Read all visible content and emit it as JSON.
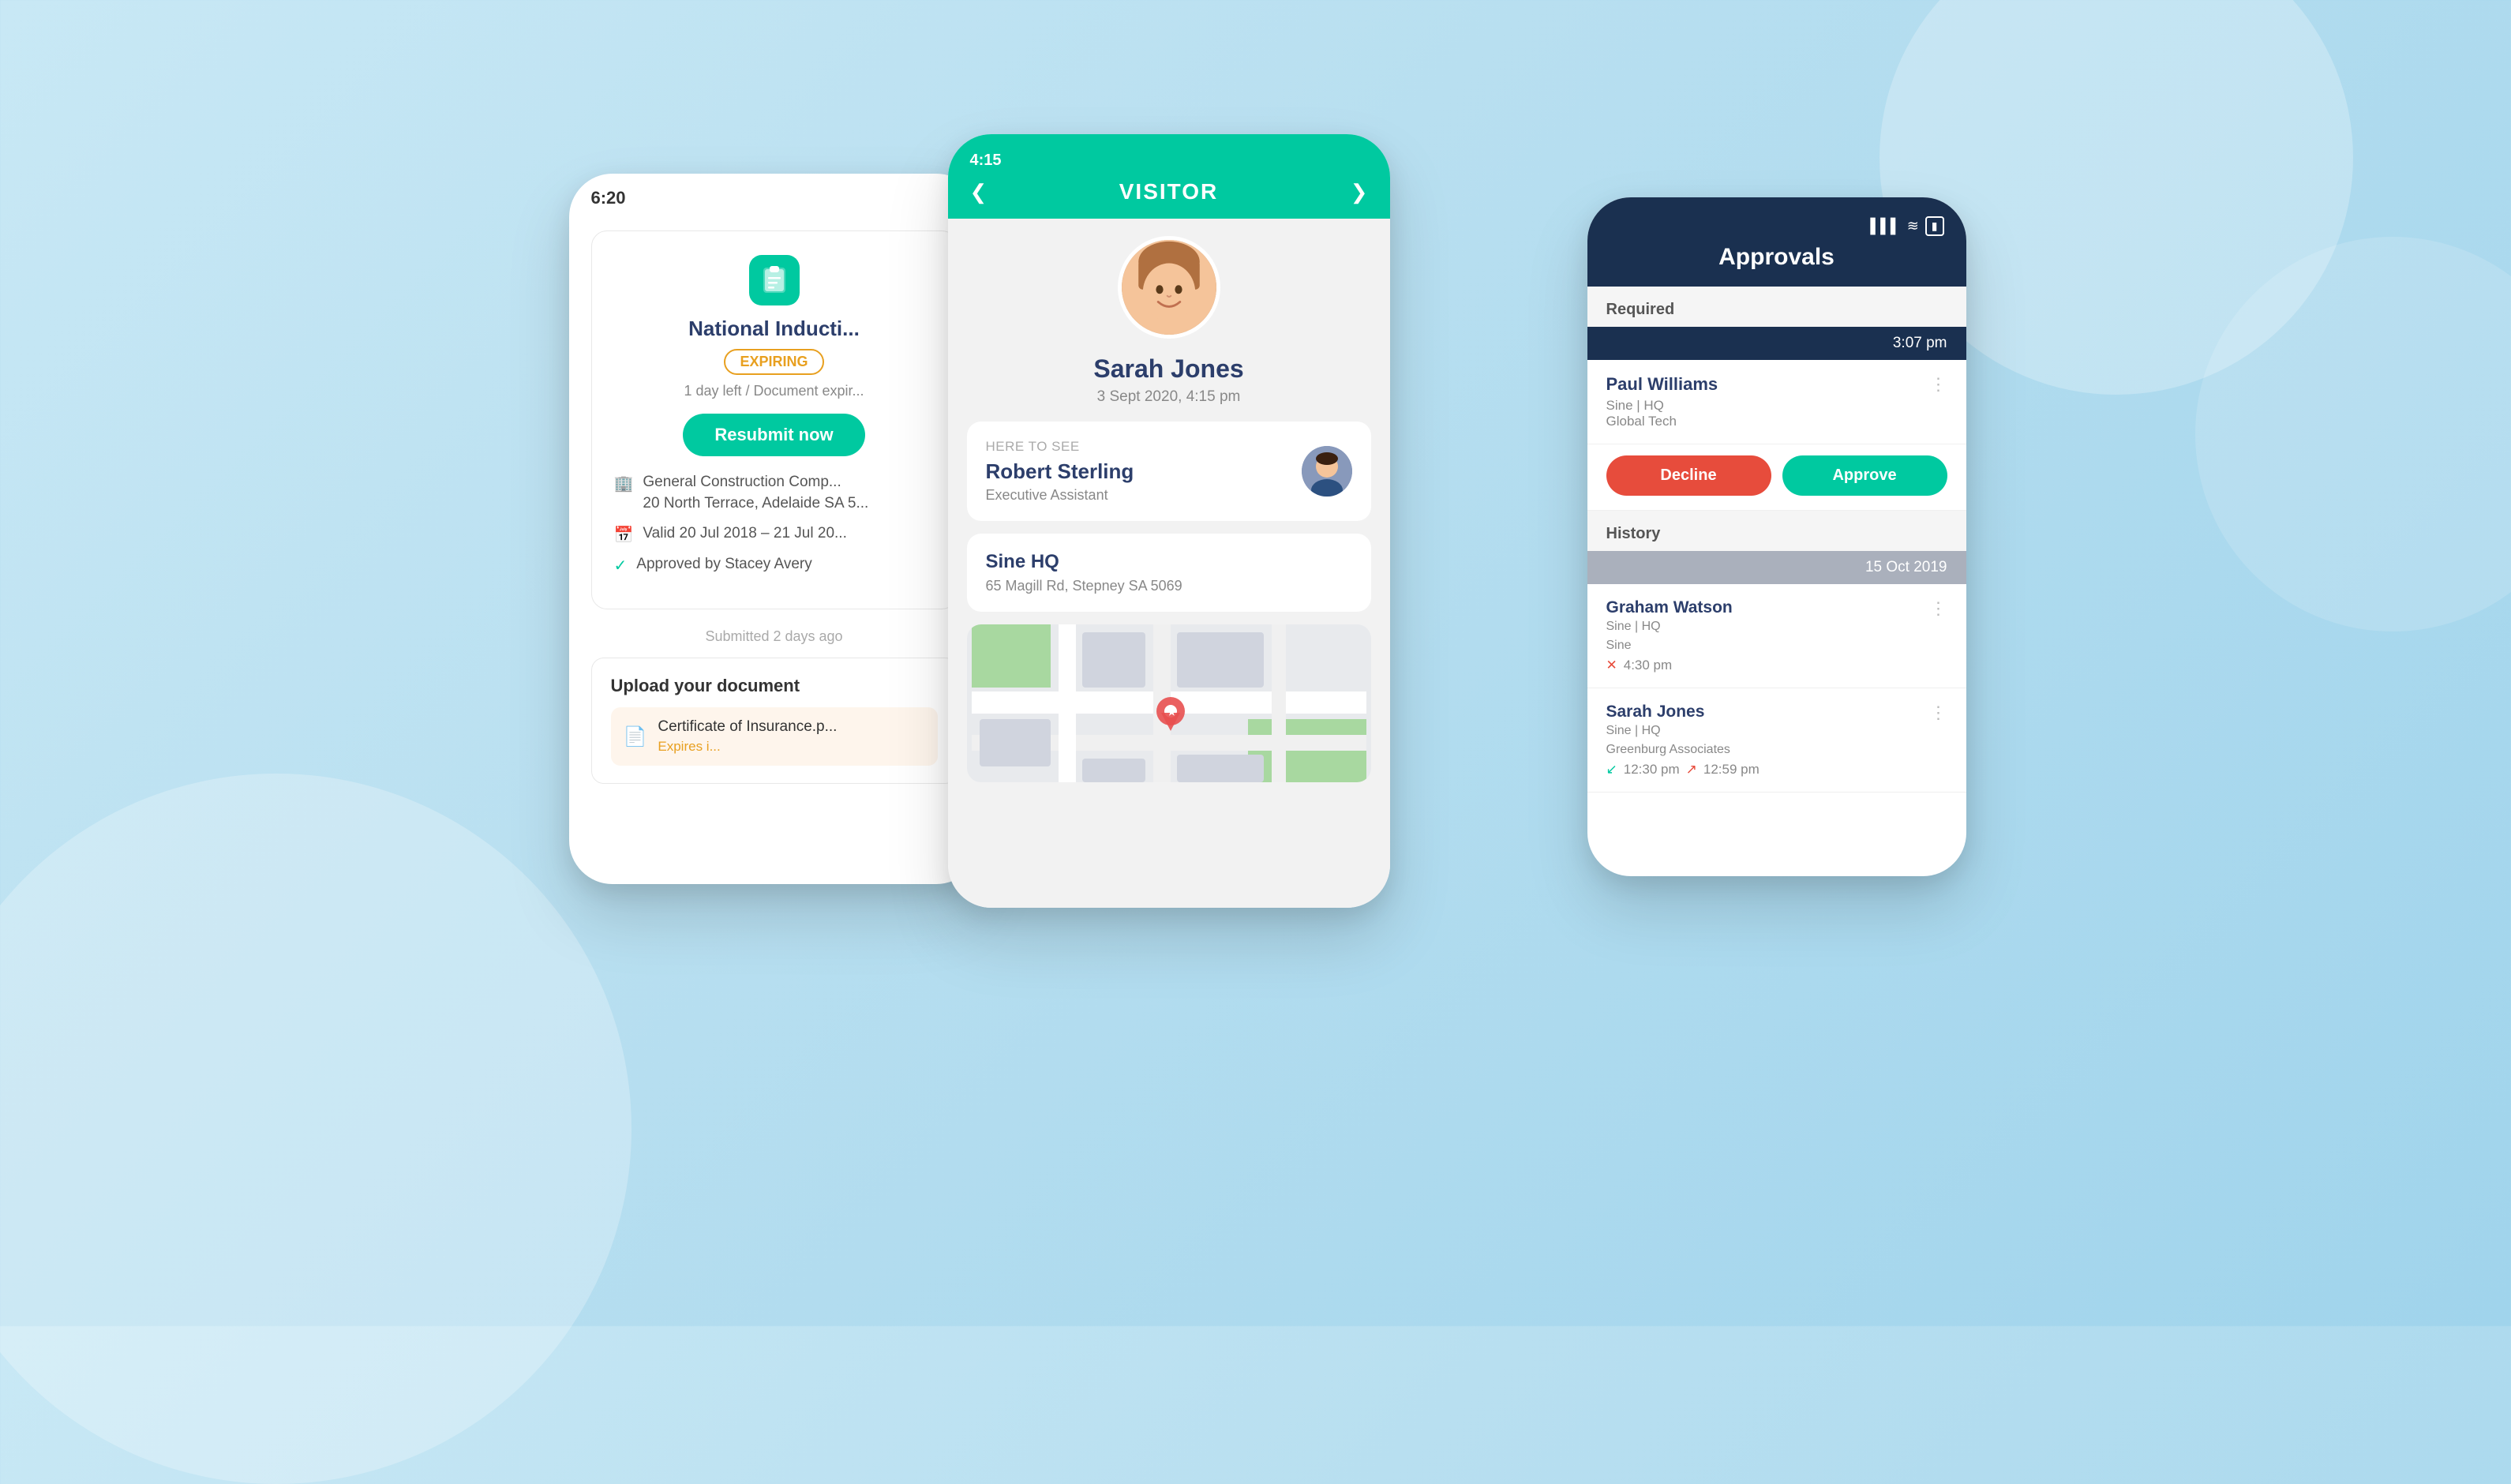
{
  "background": {
    "color": "#c2e4f5"
  },
  "phone_left": {
    "status_bar": "6:20",
    "induction_card": {
      "title": "National Inducti...",
      "badge": "EXPIRING",
      "expiry_text": "1 day left / Document expir...",
      "resubmit_label": "Resubmit now",
      "company_name": "General Construction Comp...",
      "company_address": "20 North Terrace, Adelaide SA 5...",
      "valid_dates": "Valid 20 Jul 2018 – 21 Jul 20...",
      "approved_by": "Approved by Stacey Avery"
    },
    "submitted_text": "Submitted 2 days ago",
    "upload_section": {
      "title": "Upload your document",
      "file_name": "Certificate of Insurance.p...",
      "file_expires": "Expires i..."
    }
  },
  "phone_center": {
    "status_bar": "4:15",
    "header_title": "VISITOR",
    "visitor_name": "Sarah Jones",
    "visitor_date": "3 Sept 2020, 4:15 pm",
    "here_to_see_label": "HERE TO SEE",
    "host_name": "Robert Sterling",
    "host_role": "Executive Assistant",
    "location_name": "Sine HQ",
    "location_address": "65 Magill Rd, Stepney SA 5069"
  },
  "phone_right": {
    "status_bar_signal": "▌▌▌",
    "status_bar_wifi": "WiFi",
    "status_bar_battery": "Battery",
    "header_title": "Approvals",
    "required_label": "Required",
    "time_bar": "3:07 pm",
    "approval_person": {
      "name": "Paul Williams",
      "company_line1": "Sine | HQ",
      "company_line2": "Global Tech"
    },
    "decline_label": "Decline",
    "approve_label": "Approve",
    "history_label": "History",
    "history_date_bar": "15 Oct 2019",
    "history_items": [
      {
        "name": "Graham Watson",
        "company_line1": "Sine | HQ",
        "company_line2": "Sine",
        "time": "4:30 pm",
        "status": "declined"
      },
      {
        "name": "Sarah Jones",
        "company_line1": "Sine | HQ",
        "company_line2": "Greenburg Associates",
        "time_in": "12:30 pm",
        "time_out": "12:59 pm",
        "status": "checked_out"
      }
    ]
  },
  "icons": {
    "clipboard": "📋",
    "building": "🏢",
    "calendar": "📅",
    "check": "✓",
    "pdf": "📄",
    "arrow_down": "❯",
    "three_dots": "⋮",
    "cross": "✕",
    "arrow_in": "↙",
    "arrow_out": "↗"
  }
}
